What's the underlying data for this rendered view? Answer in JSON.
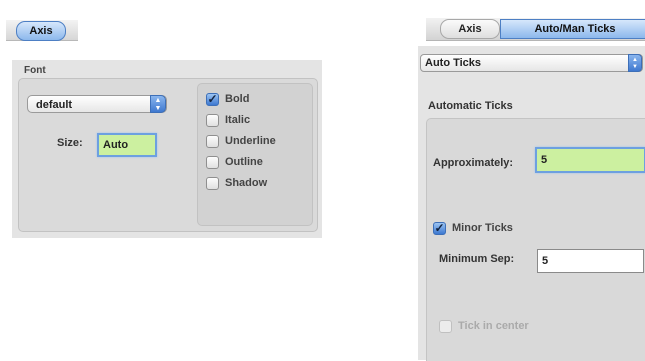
{
  "left_panel": {
    "tab": {
      "label": "Axis"
    },
    "font_group": {
      "legend": "Font",
      "font_popup": {
        "value": "default"
      },
      "size": {
        "label": "Size:",
        "value": "Auto"
      },
      "styles": [
        {
          "label": "Bold",
          "checked": true
        },
        {
          "label": "Italic",
          "checked": false
        },
        {
          "label": "Underline",
          "checked": false
        },
        {
          "label": "Outline",
          "checked": false
        },
        {
          "label": "Shadow",
          "checked": false
        }
      ]
    }
  },
  "right_panel": {
    "tabs": [
      {
        "label": "Axis",
        "selected": false
      },
      {
        "label": "Auto/Man Ticks",
        "selected": true
      }
    ],
    "mode_popup": {
      "value": "Auto Ticks"
    },
    "section_title": "Automatic Ticks",
    "approximately": {
      "label": "Approximately:",
      "value": "5"
    },
    "minor_ticks": {
      "label": "Minor Ticks",
      "checked": true
    },
    "minimum_sep": {
      "label": "Minimum Sep:",
      "value": "5"
    },
    "tick_in_center": {
      "label": "Tick in center",
      "checked": false,
      "enabled": false
    }
  },
  "colors": {
    "selected_tab": "#8db8ec",
    "focused_field": "#ccf0a0",
    "panel_bg": "#e4e4e4"
  },
  "icons": {
    "popup_arrows": "updown-arrows-icon",
    "check": "checkmark-icon"
  }
}
